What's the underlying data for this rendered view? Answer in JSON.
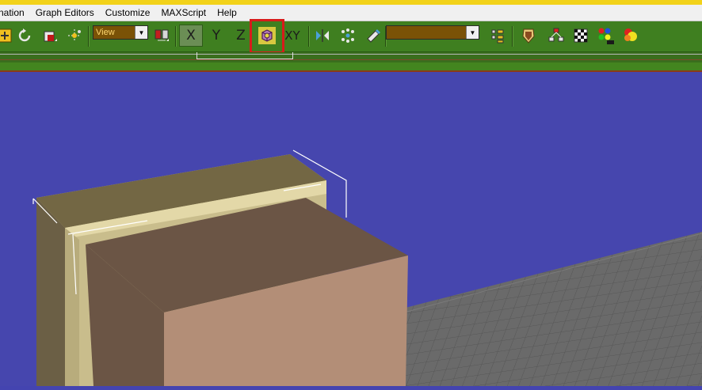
{
  "menubar": {
    "items": [
      "nation",
      "Graph Editors",
      "Customize",
      "MAXScript",
      "Help"
    ]
  },
  "toolbar": {
    "reference_coord_dropdown": {
      "value": "View"
    },
    "named_selection_dropdown": {
      "value": ""
    },
    "axis_labels": {
      "x": "X",
      "y": "Y",
      "z": "Z",
      "xy": "XY"
    },
    "active_axis": "x",
    "highlighted_tool": "shaded-cube-icon"
  },
  "colors": {
    "toolbar_bg": "#3f7f20",
    "viewport_bg": "#4646ae",
    "highlight_border": "#d81b1b",
    "object_tan": "#c7b98a",
    "object_brown": "#6b5545",
    "object_peach": "#b38e77",
    "grid_floor": "#666666"
  }
}
